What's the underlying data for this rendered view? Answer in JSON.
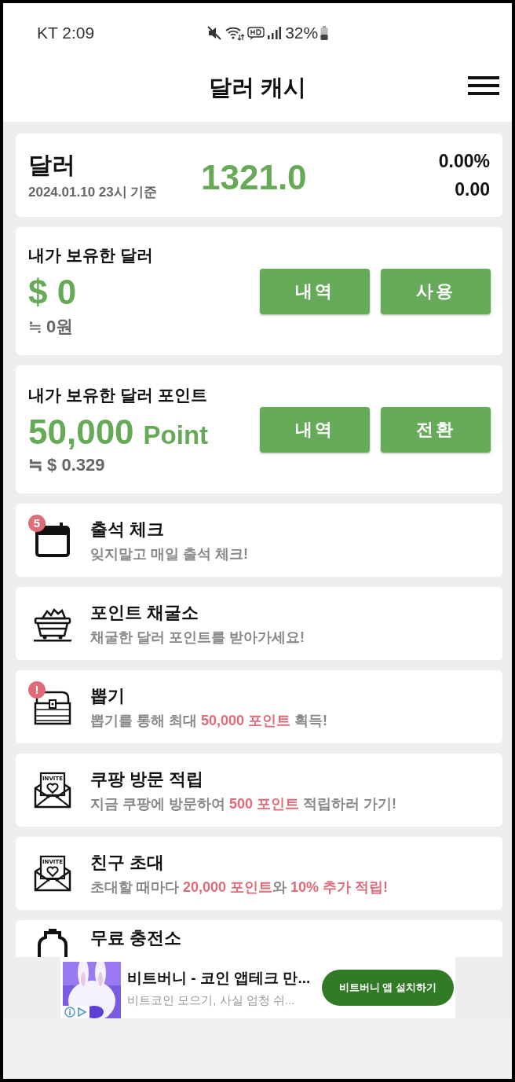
{
  "status_bar": {
    "carrier_time": "KT 2:09",
    "battery_text": "32%"
  },
  "header": {
    "title": "달러 캐시"
  },
  "rate_card": {
    "currency": "달러",
    "date": "2024.01.10 23시 기준",
    "rate": "1321.0",
    "change_percent": "0.00%",
    "change": "0.00"
  },
  "holdings": [
    {
      "title": "내가 보유한 달러",
      "amount": "$ 0",
      "approx": "≒ 0원",
      "buttons": [
        "내역",
        "사용"
      ]
    },
    {
      "title": "내가 보유한 달러 포인트",
      "amount": "50,000",
      "unit": "Point",
      "approx": "≒ $ 0.329",
      "buttons": [
        "내역",
        "전환"
      ]
    }
  ],
  "features": [
    {
      "kind": "calendar",
      "badge": "5",
      "title": "출석 체크",
      "subtitle": [
        {
          "text": "잊지말고 매일 출석 체크!",
          "highlight": false
        }
      ]
    },
    {
      "kind": "cart",
      "title": "포인트 채굴소",
      "subtitle": [
        {
          "text": "채굴한 달러 포인트를 받아가세요!",
          "highlight": false
        }
      ]
    },
    {
      "kind": "chest",
      "badge": "!",
      "title": "뽑기",
      "subtitle": [
        {
          "text": "뽑기를 통해 최대 ",
          "highlight": false
        },
        {
          "text": "50,000 포인트",
          "highlight": true
        },
        {
          "text": " 획득!",
          "highlight": false
        }
      ]
    },
    {
      "kind": "invite",
      "icon_text": "INVITE",
      "title": "쿠팡 방문 적립",
      "subtitle": [
        {
          "text": "지금 쿠팡에 방문하여 ",
          "highlight": false
        },
        {
          "text": "500 포인트",
          "highlight": true
        },
        {
          "text": " 적립하러 가기!",
          "highlight": false
        }
      ]
    },
    {
      "kind": "invite",
      "icon_text": "INVITE",
      "title": "친구 초대",
      "subtitle": [
        {
          "text": "초대할 때마다 ",
          "highlight": false
        },
        {
          "text": "20,000 포인트",
          "highlight": true
        },
        {
          "text": "와 ",
          "highlight": false
        },
        {
          "text": "10% 추가 적립!",
          "highlight": true
        }
      ]
    },
    {
      "kind": "bottle",
      "title": "무료 충전소"
    }
  ],
  "ad": {
    "title": "비트버니 - 코인 앱테크 만...",
    "description": "비트코인 모으기, 사실 엄청 쉬...",
    "button": "비트버니 앱 설치하기"
  }
}
